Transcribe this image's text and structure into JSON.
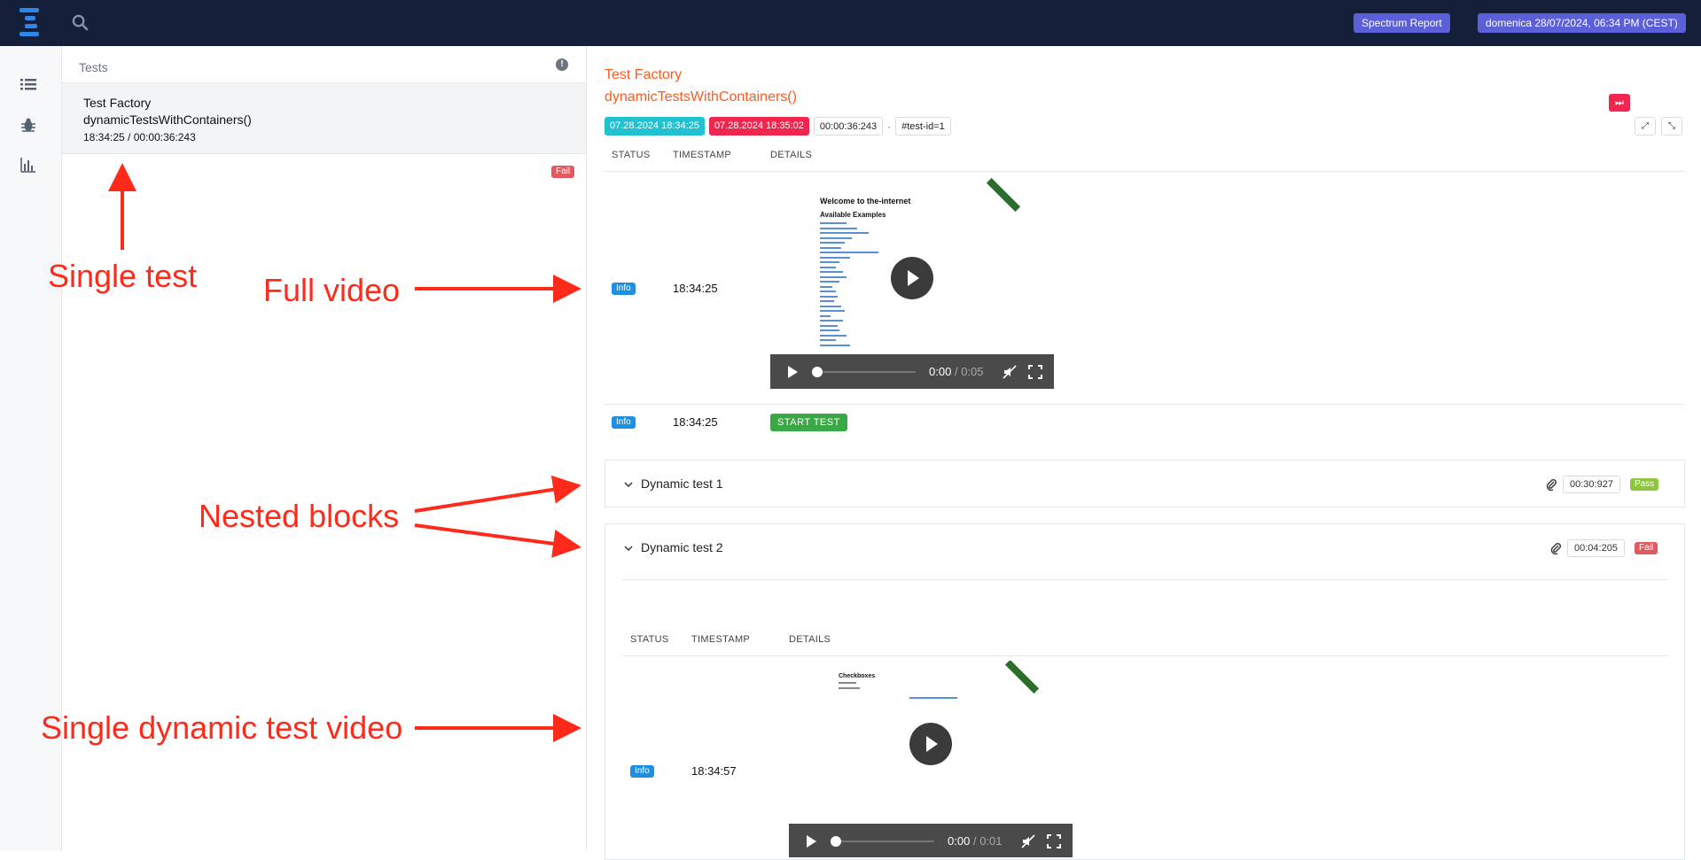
{
  "topbar": {
    "logo_icon": "logo-icon",
    "search_icon": "search-icon",
    "report_pill": "Spectrum Report",
    "user_pill": "domenica 28/07/2024, 06:34 PM (CEST)"
  },
  "sidenav": {
    "items": [
      {
        "icon": "list-icon"
      },
      {
        "icon": "bug-icon"
      },
      {
        "icon": "bar-chart-icon"
      }
    ]
  },
  "tests_panel": {
    "header": "Tests",
    "info_icon": "info-icon",
    "items": [
      {
        "class_name": "Test Factory",
        "method_name": "dynamicTestsWithContainers()",
        "time": "18:34:25 / 00:00:36:243",
        "status": "Fail"
      }
    ]
  },
  "main": {
    "class_name": "Test Factory",
    "method_name": "dynamicTestsWithContainers()",
    "start_time": "07.28.2024 18:34:25",
    "end_time": "07.28.2024 18:35:02",
    "duration": "00:00:36:243",
    "separator": "·",
    "test_id": "#test-id=1",
    "columns": {
      "status": "STATUS",
      "timestamp": "TIMESTAMP",
      "details": "DETAILS"
    },
    "logs": [
      {
        "status": "Info",
        "timestamp": "18:34:25",
        "video": {
          "preview_title": "Welcome to the-internet",
          "preview_subtitle": "Available Examples",
          "current": "0:00",
          "duration": "0:05",
          "separator": "/",
          "progress": 0.0
        }
      },
      {
        "status": "Info",
        "timestamp": "18:34:25",
        "label": "START TEST"
      }
    ],
    "nested_blocks": [
      {
        "title": "Dynamic test 1",
        "duration": "00:30:927",
        "status": "Pass"
      },
      {
        "title": "Dynamic test 2",
        "duration": "00:04:205",
        "status": "Fail",
        "columns": {
          "status": "STATUS",
          "timestamp": "TIMESTAMP",
          "details": "DETAILS"
        },
        "logs": [
          {
            "status": "Info",
            "timestamp": "18:34:57",
            "video": {
              "preview_title": "Checkboxes",
              "current": "0:00",
              "duration": "0:01",
              "separator": "/",
              "progress": 0.0
            }
          }
        ]
      }
    ]
  },
  "annotations": {
    "single_test": "Single test",
    "full_video": "Full video",
    "nested_blocks": "Nested blocks",
    "single_dynamic_test_video": "Single dynamic test video"
  },
  "colors": {
    "topbar": "#14203a",
    "accent_title": "#ff5a1f",
    "annotation": "#ff2a1a",
    "pill": "#5b5fd8",
    "fail": "#e05a5f",
    "pass": "#8dc63f",
    "info": "#1e8fe1",
    "start_chip": "#22c1cf",
    "end_chip": "#f1264e"
  }
}
